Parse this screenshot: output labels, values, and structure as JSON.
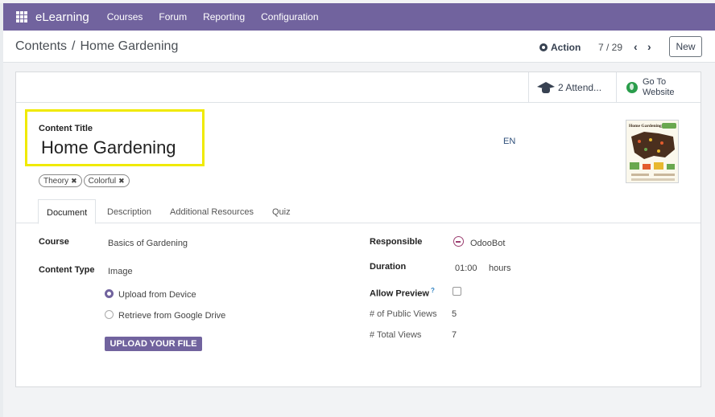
{
  "nav": {
    "brand": "eLearning",
    "menu": [
      "Courses",
      "Forum",
      "Reporting",
      "Configuration"
    ]
  },
  "breadcrumb": {
    "parent": "Contents",
    "separator": "/",
    "current": "Home Gardening"
  },
  "control": {
    "action_label": "Action",
    "pager": "7 / 29",
    "prev": "‹",
    "next": "›",
    "new_label": "New"
  },
  "stat_buttons": {
    "attendees": "2 Attend...",
    "website_line1": "Go To",
    "website_line2": "Website"
  },
  "content": {
    "title_label": "Content Title",
    "title": "Home Gardening",
    "lang": "EN",
    "thumbnail_title": "Home Gardening",
    "tags": [
      "Theory",
      "Colorful"
    ]
  },
  "tabs": [
    "Document",
    "Description",
    "Additional Resources",
    "Quiz"
  ],
  "form": {
    "course_label": "Course",
    "course_value": "Basics of Gardening",
    "content_type_label": "Content Type",
    "content_type_value": "Image",
    "radio_upload": "Upload from Device",
    "radio_drive": "Retrieve from Google Drive",
    "upload_button": "UPLOAD YOUR FILE",
    "responsible_label": "Responsible",
    "responsible_value": "OdooBot",
    "duration_label": "Duration",
    "duration_value": "01:00",
    "duration_unit": "hours",
    "allow_preview_label": "Allow Preview",
    "help_mark": "?",
    "public_views_label": "# of Public Views",
    "public_views_value": "5",
    "total_views_label": "# Total Views",
    "total_views_value": "7"
  },
  "colors": {
    "brand": "#71639e",
    "highlight": "#f0ea00"
  }
}
